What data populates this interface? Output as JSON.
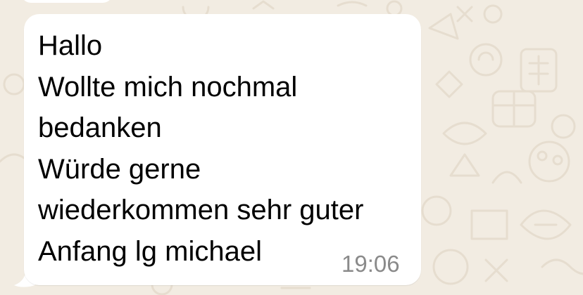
{
  "chat": {
    "message": {
      "lines": [
        "Hallo",
        "Wollte mich nochmal",
        "bedanken",
        "Würde gerne",
        "wiederkommen sehr guter",
        "Anfang lg michael"
      ],
      "time": "19:06"
    }
  },
  "colors": {
    "wallpaper": "#f2ece2",
    "bubble": "#ffffff",
    "text": "#000000",
    "timestamp": "#8a8a8a"
  }
}
